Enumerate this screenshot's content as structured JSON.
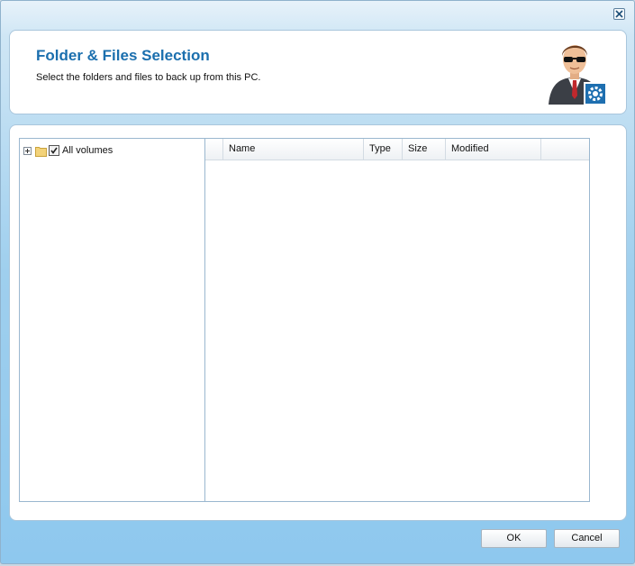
{
  "header": {
    "title": "Folder & Files Selection",
    "subtitle": "Select the folders and files to back up from this PC."
  },
  "tree": {
    "root_label": "All volumes",
    "root_checked": true
  },
  "grid": {
    "columns": [
      "",
      "Name",
      "Type",
      "Size",
      "Modified",
      ""
    ],
    "rows": []
  },
  "buttons": {
    "ok": "OK",
    "cancel": "Cancel"
  },
  "icons": {
    "close": "close-icon",
    "avatar": "user-settings-icon",
    "folder": "folder-icon"
  },
  "colors": {
    "title": "#1b6fae",
    "accent": "#8ec8ee"
  }
}
